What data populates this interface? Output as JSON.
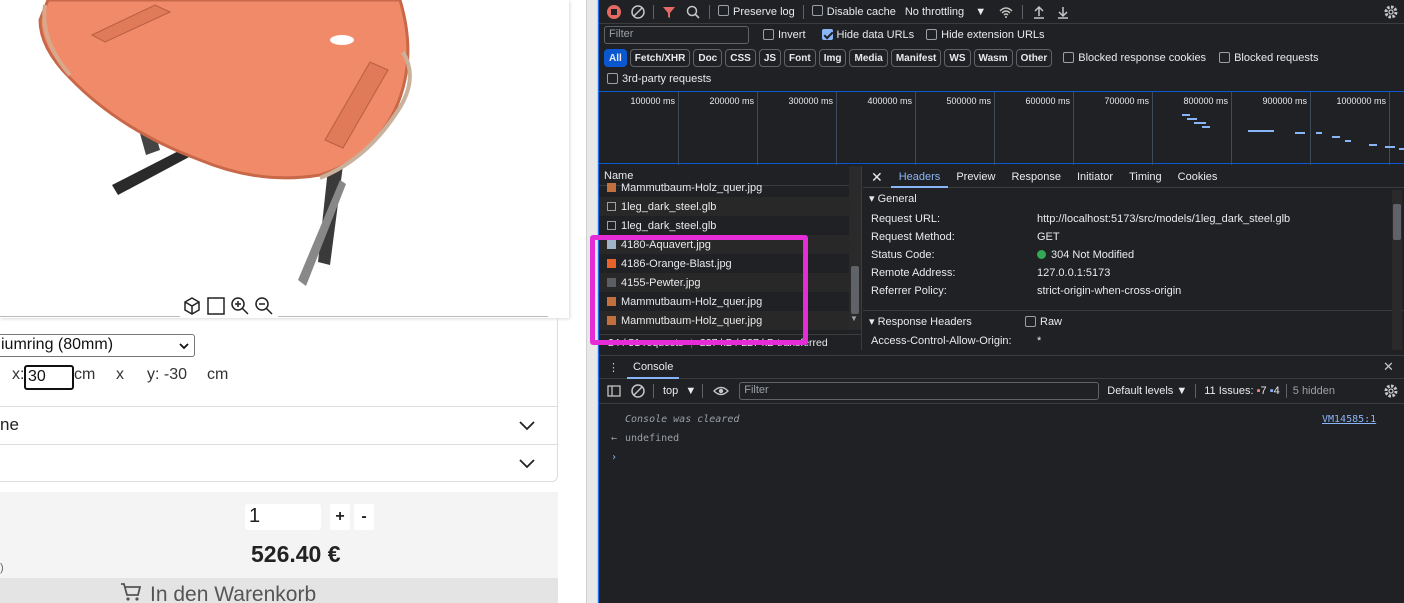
{
  "configurator": {
    "tools": [
      "cube-icon",
      "square-icon",
      "zoom-in-icon",
      "zoom-out-icon"
    ],
    "ring_select": "iumring (80mm)",
    "x_label": "x:",
    "x_value": "30",
    "cm1": "cm",
    "times": "x",
    "y_text": "y: -30",
    "cm2": "cm",
    "accordion1": "ne",
    "quantity": "1",
    "plus": "+",
    "minus": "-",
    "price": "526.40 €",
    "paren": ")",
    "cart_label": "In den Warenkorb",
    "table_color": "#f07850"
  },
  "devtools": {
    "toolbar": {
      "preserve_log": "Preserve log",
      "disable_cache": "Disable cache",
      "throttling": "No throttling"
    },
    "filter": {
      "placeholder": "Filter",
      "invert": "Invert",
      "hide_data_urls": "Hide data URLs",
      "hide_ext_urls": "Hide extension URLs",
      "types": [
        "All",
        "Fetch/XHR",
        "Doc",
        "CSS",
        "JS",
        "Font",
        "Img",
        "Media",
        "Manifest",
        "WS",
        "Wasm",
        "Other"
      ],
      "blocked_cookies": "Blocked response cookies",
      "blocked_requests": "Blocked requests",
      "third_party": "3rd-party requests"
    },
    "timeline_labels": [
      "100000 ms",
      "200000 ms",
      "300000 ms",
      "400000 ms",
      "500000 ms",
      "600000 ms",
      "700000 ms",
      "800000 ms",
      "900000 ms",
      "1000000 ms"
    ],
    "requests": {
      "header": "Name",
      "rows": [
        {
          "name": "Mammutbaum-Holz_quer.jpg",
          "icon": "wood"
        },
        {
          "name": "1leg_dark_steel.glb",
          "icon": "file"
        },
        {
          "name": "1leg_dark_steel.glb",
          "icon": "file"
        },
        {
          "name": "4180-Aquavert.jpg",
          "icon": "aqua"
        },
        {
          "name": "4186-Orange-Blast.jpg",
          "icon": "orange"
        },
        {
          "name": "4155-Pewter.jpg",
          "icon": "pewter"
        },
        {
          "name": "Mammutbaum-Holz_quer.jpg",
          "icon": "wood"
        },
        {
          "name": "Mammutbaum-Holz_quer.jpg",
          "icon": "wood"
        }
      ],
      "status_count": "24 / 51 requests",
      "status_size": "227 kB / 227 kB transferred"
    },
    "details": {
      "tabs": [
        "Headers",
        "Preview",
        "Response",
        "Initiator",
        "Timing",
        "Cookies"
      ],
      "general_title": "General",
      "general": [
        {
          "k": "Request URL:",
          "v": "http://localhost:5173/src/models/1leg_dark_steel.glb"
        },
        {
          "k": "Request Method:",
          "v": "GET"
        },
        {
          "k": "Status Code:",
          "v": "304 Not Modified"
        },
        {
          "k": "Remote Address:",
          "v": "127.0.0.1:5173"
        },
        {
          "k": "Referrer Policy:",
          "v": "strict-origin-when-cross-origin"
        }
      ],
      "response_headers_title": "Response Headers",
      "raw": "Raw",
      "acao_key": "Access-Control-Allow-Origin:",
      "acao_val": "*"
    },
    "console": {
      "tab": "Console",
      "context": "top",
      "filter_placeholder": "Filter",
      "levels": "Default levels",
      "issues_label": "11 Issues:",
      "issues_err": "7",
      "issues_info": "4",
      "hidden": "5 hidden",
      "cleared": "Console was cleared",
      "source": "VM14585:1",
      "undefined": "undefined"
    }
  }
}
